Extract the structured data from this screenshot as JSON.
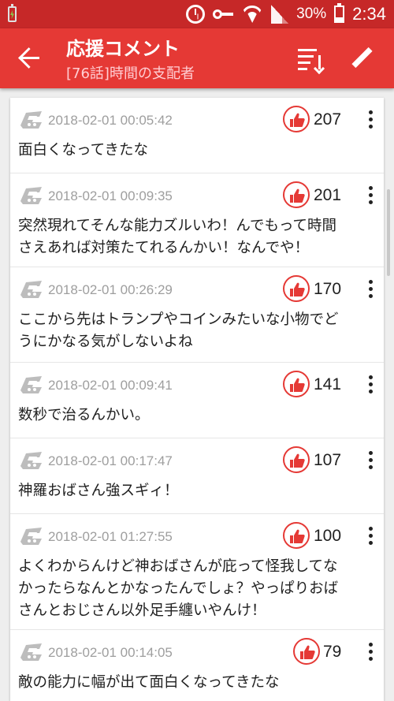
{
  "status_bar": {
    "battery_percent": "30%",
    "time": "2:34",
    "battery_level": 0.3
  },
  "app_bar": {
    "title": "応援コメント",
    "subtitle": "[76話]時間の支配者",
    "back_icon": "arrow-back-icon",
    "sort_icon": "sort-icon",
    "edit_icon": "edit-icon"
  },
  "colors": {
    "status": "#c62828",
    "appbar": "#e53935",
    "accent": "#e53935"
  },
  "comments": [
    {
      "date": "2018-02-01 00:05:42",
      "likes": "207",
      "text": "面白くなってきたな"
    },
    {
      "date": "2018-02-01 00:09:35",
      "likes": "201",
      "text": "突然現れてそんな能力ズルいわ！んでもって時間\nさえあれば対策たてれるんかい！なんでや！"
    },
    {
      "date": "2018-02-01 00:26:29",
      "likes": "170",
      "text": "ここから先はトランプやコインみたいな小物でど\nうにかなる気がしないよね"
    },
    {
      "date": "2018-02-01 00:09:41",
      "likes": "141",
      "text": "数秒で治るんかい。"
    },
    {
      "date": "2018-02-01 00:17:47",
      "likes": "107",
      "text": "神羅おばさん強スギィ！"
    },
    {
      "date": "2018-02-01 01:27:55",
      "likes": "100",
      "text": "よくわからんけど神おばさんが庇って怪我してな\nかったらなんとかなったんでしょ？やっぱりおば\nさんとおじさん以外足手纏いやんけ！"
    },
    {
      "date": "2018-02-01 00:14:05",
      "likes": "79",
      "text": "敵の能力に幅が出て面白くなってきたな"
    }
  ]
}
